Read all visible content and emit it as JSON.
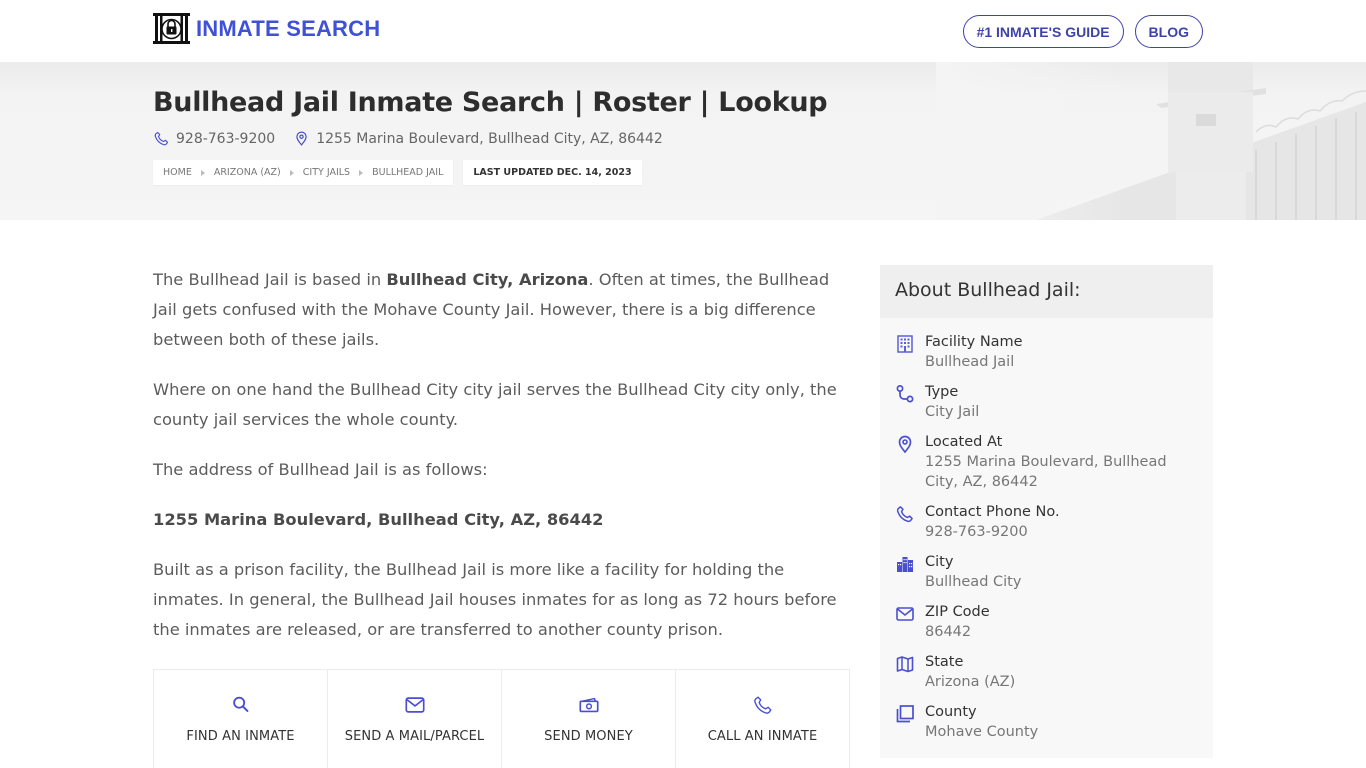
{
  "header": {
    "brand": "INMATE SEARCH",
    "nav": [
      {
        "label": "#1 INMATE'S GUIDE"
      },
      {
        "label": "BLOG"
      }
    ]
  },
  "hero": {
    "title": "Bullhead Jail Inmate Search | Roster | Lookup",
    "phone": "928-763-9200",
    "address": "1255 Marina Boulevard, Bullhead City, AZ, 86442",
    "breadcrumbs": [
      "HOME",
      "ARIZONA (AZ)",
      "CITY JAILS",
      "BULLHEAD JAIL"
    ],
    "last_updated": "LAST UPDATED DEC. 14, 2023"
  },
  "content": {
    "p1_a": "The Bullhead Jail is based in ",
    "p1_bold": "Bullhead City, Arizona",
    "p1_b": ". Often at times, the Bullhead Jail gets confused with the Mohave County Jail. However, there is a big difference between both of these jails.",
    "p2": "Where on one hand the Bullhead City city jail serves the Bullhead City city only, the county jail services the whole county.",
    "p3": "The address of Bullhead Jail is as follows:",
    "p4_bold": "1255 Marina Boulevard, Bullhead City, AZ, 86442",
    "p5": "Built as a prison facility, the Bullhead Jail is more like a facility for holding the inmates. In general, the Bullhead Jail houses inmates for as long as 72 hours before the inmates are released, or are transferred to another county prison."
  },
  "actions": [
    {
      "label": "FIND AN INMATE",
      "icon": "search-icon"
    },
    {
      "label": "SEND A MAIL/PARCEL",
      "icon": "mail-icon"
    },
    {
      "label": "SEND MONEY",
      "icon": "money-icon"
    },
    {
      "label": "CALL AN INMATE",
      "icon": "phone-icon"
    }
  ],
  "sidebar": {
    "title": "About Bullhead Jail:",
    "items": [
      {
        "key": "Facility Name",
        "value": "Bullhead Jail",
        "icon": "building-icon"
      },
      {
        "key": "Type",
        "value": "City Jail",
        "icon": "route-icon"
      },
      {
        "key": "Located At",
        "value": "1255 Marina Boulevard, Bullhead City, AZ, 86442",
        "icon": "location-pin-icon"
      },
      {
        "key": "Contact Phone No.",
        "value": "928-763-9200",
        "icon": "phone-icon"
      },
      {
        "key": "City",
        "value": "Bullhead City",
        "icon": "city-icon"
      },
      {
        "key": "ZIP Code",
        "value": "86442",
        "icon": "envelope-icon"
      },
      {
        "key": "State",
        "value": "Arizona (AZ)",
        "icon": "map-icon"
      },
      {
        "key": "County",
        "value": "Mohave County",
        "icon": "copy-icon"
      }
    ]
  },
  "colors": {
    "brand": "#3f51d6",
    "nav_border": "#3d43a8",
    "icon": "#4a4fd0",
    "title": "#2d2d2d",
    "text": "#5c5c5c"
  }
}
